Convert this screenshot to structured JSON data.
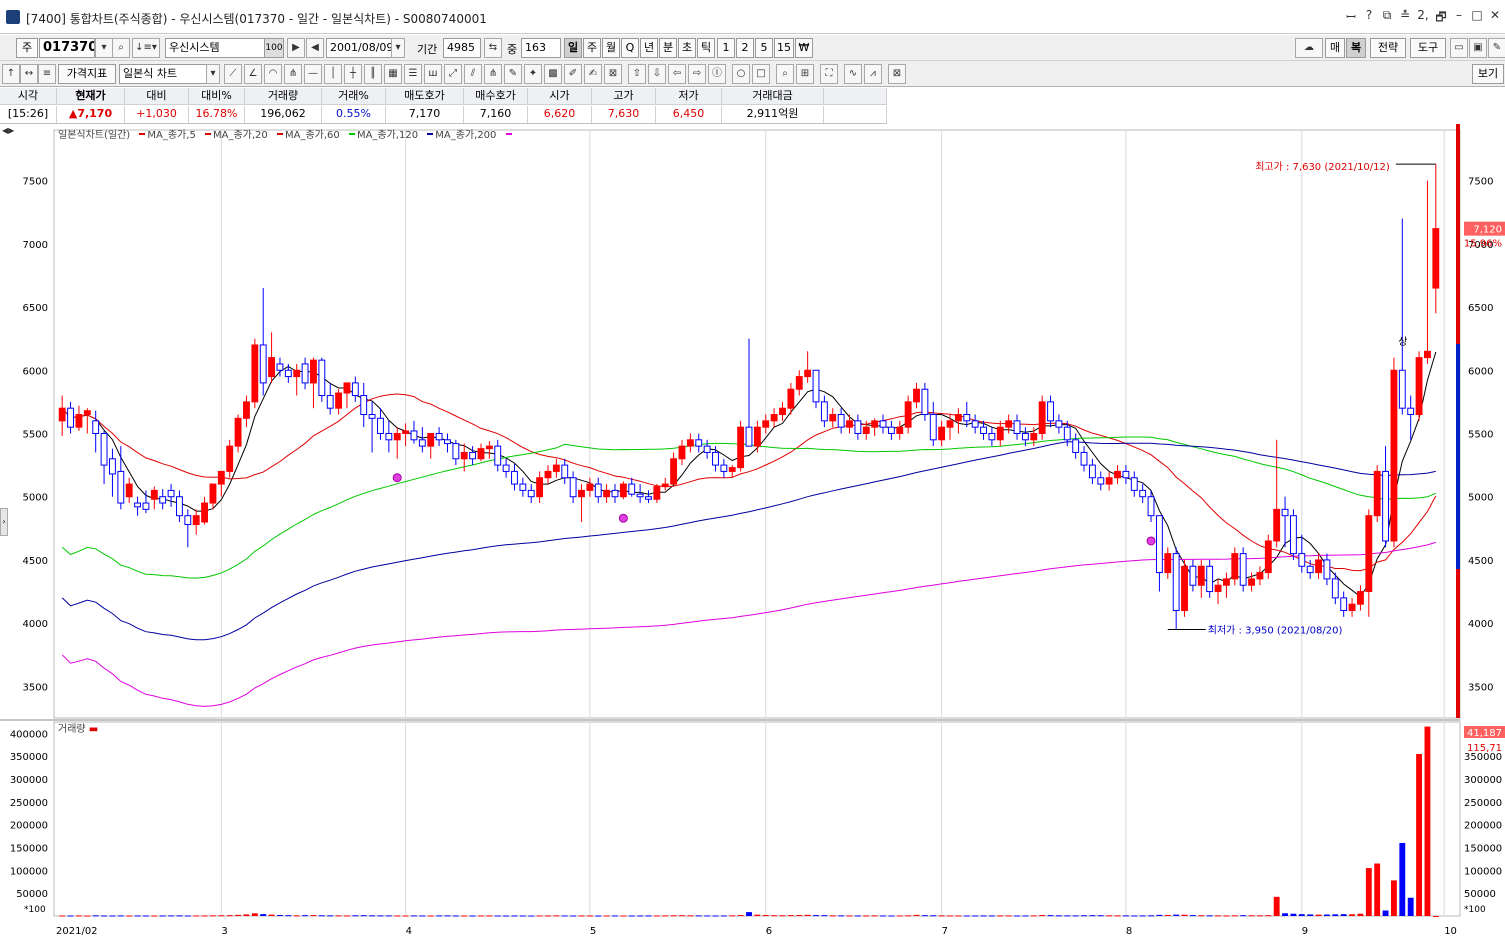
{
  "window": {
    "title": "[7400] 통합차트(주식종합) - 우신시스템(017370 - 일간 - 일본식차트) - S0080740001",
    "controls": [
      "ꟷ",
      "?",
      "⧉",
      "≛",
      "2,",
      "🗗",
      "–",
      "□",
      "✕"
    ]
  },
  "toolbar1": {
    "market": "주",
    "code": "017370",
    "name": "우신시스템",
    "name_suffix": "100",
    "date": "2001/08/09",
    "period_label": "기간",
    "period_value": "4985",
    "count_label": "중",
    "count_value": "163",
    "timeframes": [
      "일",
      "주",
      "월",
      "Q",
      "년",
      "분",
      "초",
      "틱",
      "1",
      "2",
      "5",
      "15",
      "₩"
    ],
    "right_buttons": [
      "매",
      "복",
      "전략",
      "도구"
    ]
  },
  "toolbar2": {
    "indicator_button": "가격지표",
    "chart_type": "일본식 차트",
    "view_button": "보기"
  },
  "quote": {
    "headers": [
      "시각",
      "현재가",
      "대비",
      "대비%",
      "거래량",
      "거래%",
      "매도호가",
      "매수호가",
      "시가",
      "고가",
      "저가",
      "거래대금"
    ],
    "values": [
      "[15:26]",
      "▲7,170",
      "+1,030",
      "16.78%",
      "196,062",
      "0.55%",
      "7,170",
      "7,160",
      "6,620",
      "7,630",
      "6,450",
      "2,911억원"
    ]
  },
  "chart_legend": {
    "title": "일본식차트(일간)",
    "items": [
      {
        "label": "MA_종가,5",
        "color": "#000000"
      },
      {
        "label": "MA_종가,20",
        "color": "#e00000"
      },
      {
        "label": "MA_종가,60",
        "color": "#00c800"
      },
      {
        "label": "MA_종가,120",
        "color": "#0000a0"
      },
      {
        "label": "MA_종가,200",
        "color": "#e000e0"
      }
    ]
  },
  "annotations": {
    "high": "최고가 : 7,630 (2021/10/12)",
    "low": "최저가 : 3,950 (2021/08/20)",
    "up_mark": "상",
    "current_price": "7,120",
    "current_pct": "15.96%",
    "volume_last": "41,187",
    "volume_ma": "115,71",
    "scale_tag": "*100"
  },
  "volume_legend": "거래량",
  "chart_data": [
    {
      "type": "candlestick",
      "title": "일본식차트(일간)",
      "x_labels": [
        "2021/02",
        "3",
        "4",
        "5",
        "6",
        "7",
        "8",
        "9",
        "10"
      ],
      "yticks": [
        3500,
        4000,
        4500,
        5000,
        5500,
        6000,
        6500,
        7000,
        7500
      ],
      "ylim": [
        3250,
        7900
      ],
      "candles": [
        [
          5600,
          5800,
          5480,
          5700
        ],
        [
          5700,
          5750,
          5500,
          5550
        ],
        [
          5550,
          5720,
          5520,
          5650
        ],
        [
          5650,
          5700,
          5500,
          5680
        ],
        [
          5600,
          5680,
          5350,
          5500
        ],
        [
          5500,
          5520,
          5100,
          5250
        ],
        [
          5300,
          5380,
          5000,
          5180
        ],
        [
          5200,
          5400,
          4900,
          4950
        ],
        [
          5000,
          5150,
          4950,
          5100
        ],
        [
          4950,
          5000,
          4850,
          4920
        ],
        [
          4950,
          5050,
          4870,
          4900
        ],
        [
          4980,
          5080,
          4900,
          5050
        ],
        [
          5000,
          5060,
          4900,
          4950
        ],
        [
          5050,
          5100,
          4920,
          5000
        ],
        [
          5000,
          5050,
          4800,
          4850
        ],
        [
          4850,
          4900,
          4600,
          4780
        ],
        [
          4780,
          4900,
          4700,
          4850
        ],
        [
          4800,
          5000,
          4780,
          4950
        ],
        [
          4950,
          5100,
          4900,
          5100
        ],
        [
          5100,
          5200,
          5000,
          5200
        ],
        [
          5200,
          5450,
          5150,
          5400
        ],
        [
          5400,
          5650,
          5350,
          5620
        ],
        [
          5620,
          5800,
          5550,
          5750
        ],
        [
          5750,
          6250,
          5700,
          6200
        ],
        [
          6200,
          6650,
          5800,
          5900
        ],
        [
          5950,
          6300,
          5900,
          6100
        ],
        [
          6050,
          6100,
          5950,
          6000
        ],
        [
          6000,
          6050,
          5900,
          5950
        ],
        [
          5950,
          6050,
          5800,
          6000
        ],
        [
          6050,
          6100,
          5850,
          5900
        ],
        [
          5900,
          6100,
          5700,
          6080
        ],
        [
          6080,
          6100,
          5750,
          5800
        ],
        [
          5800,
          5900,
          5650,
          5700
        ],
        [
          5700,
          5850,
          5650,
          5820
        ],
        [
          5820,
          5900,
          5700,
          5900
        ],
        [
          5900,
          5950,
          5750,
          5800
        ],
        [
          5800,
          5900,
          5550,
          5650
        ],
        [
          5650,
          5750,
          5350,
          5620
        ],
        [
          5620,
          5700,
          5450,
          5500
        ],
        [
          5500,
          5600,
          5350,
          5450
        ],
        [
          5450,
          5550,
          5300,
          5500
        ],
        [
          5500,
          5580,
          5400,
          5520
        ],
        [
          5520,
          5600,
          5420,
          5450
        ],
        [
          5450,
          5550,
          5350,
          5400
        ],
        [
          5400,
          5500,
          5300,
          5500
        ],
        [
          5500,
          5550,
          5400,
          5450
        ],
        [
          5450,
          5500,
          5350,
          5420
        ],
        [
          5420,
          5450,
          5250,
          5300
        ],
        [
          5300,
          5420,
          5200,
          5350
        ],
        [
          5350,
          5400,
          5250,
          5300
        ],
        [
          5300,
          5420,
          5280,
          5380
        ],
        [
          5380,
          5440,
          5300,
          5400
        ],
        [
          5400,
          5450,
          5200,
          5250
        ],
        [
          5250,
          5300,
          5150,
          5200
        ],
        [
          5200,
          5260,
          5050,
          5100
        ],
        [
          5100,
          5150,
          5000,
          5050
        ],
        [
          5050,
          5100,
          4950,
          5000
        ],
        [
          5000,
          5200,
          4950,
          5150
        ],
        [
          5150,
          5250,
          5100,
          5200
        ],
        [
          5200,
          5300,
          5150,
          5250
        ],
        [
          5250,
          5300,
          5100,
          5150
        ],
        [
          5150,
          5200,
          4950,
          5000
        ],
        [
          5000,
          5100,
          4800,
          5050
        ],
        [
          5050,
          5150,
          5000,
          5100
        ],
        [
          5100,
          5150,
          4950,
          5000
        ],
        [
          5000,
          5100,
          4950,
          5050
        ],
        [
          5050,
          5100,
          4950,
          5000
        ],
        [
          5000,
          5120,
          4980,
          5100
        ],
        [
          5100,
          5150,
          5000,
          5020
        ],
        [
          5020,
          5100,
          4950,
          5000
        ],
        [
          5000,
          5050,
          4950,
          4980
        ],
        [
          4980,
          5100,
          4950,
          5080
        ],
        [
          5080,
          5150,
          5050,
          5100
        ],
        [
          5100,
          5350,
          5100,
          5300
        ],
        [
          5300,
          5450,
          5250,
          5400
        ],
        [
          5400,
          5500,
          5350,
          5450
        ],
        [
          5450,
          5500,
          5350,
          5400
        ],
        [
          5400,
          5450,
          5300,
          5350
        ],
        [
          5350,
          5400,
          5200,
          5250
        ],
        [
          5250,
          5300,
          5150,
          5200
        ],
        [
          5200,
          5250,
          5150,
          5230
        ],
        [
          5230,
          5600,
          5200,
          5550
        ],
        [
          5550,
          6250,
          5450,
          5400
        ],
        [
          5400,
          5600,
          5350,
          5550
        ],
        [
          5550,
          5650,
          5500,
          5600
        ],
        [
          5600,
          5700,
          5550,
          5650
        ],
        [
          5650,
          5750,
          5600,
          5700
        ],
        [
          5700,
          5900,
          5650,
          5850
        ],
        [
          5850,
          6000,
          5800,
          5950
        ],
        [
          5950,
          6150,
          5900,
          6000
        ],
        [
          6000,
          6000,
          5700,
          5750
        ],
        [
          5750,
          5800,
          5550,
          5600
        ],
        [
          5600,
          5700,
          5550,
          5650
        ],
        [
          5650,
          5700,
          5500,
          5550
        ],
        [
          5550,
          5650,
          5500,
          5600
        ],
        [
          5600,
          5650,
          5450,
          5500
        ],
        [
          5500,
          5600,
          5450,
          5550
        ],
        [
          5550,
          5620,
          5480,
          5600
        ],
        [
          5600,
          5650,
          5500,
          5550
        ],
        [
          5550,
          5600,
          5450,
          5500
        ],
        [
          5500,
          5600,
          5450,
          5550
        ],
        [
          5550,
          5800,
          5500,
          5750
        ],
        [
          5750,
          5900,
          5700,
          5850
        ],
        [
          5850,
          5900,
          5600,
          5650
        ],
        [
          5650,
          5750,
          5400,
          5450
        ],
        [
          5450,
          5600,
          5400,
          5550
        ],
        [
          5550,
          5650,
          5450,
          5600
        ],
        [
          5600,
          5700,
          5500,
          5650
        ],
        [
          5650,
          5750,
          5550,
          5600
        ],
        [
          5600,
          5650,
          5500,
          5550
        ],
        [
          5550,
          5600,
          5450,
          5500
        ],
        [
          5500,
          5550,
          5400,
          5450
        ],
        [
          5450,
          5600,
          5400,
          5550
        ],
        [
          5550,
          5650,
          5500,
          5600
        ],
        [
          5600,
          5650,
          5450,
          5500
        ],
        [
          5500,
          5550,
          5400,
          5450
        ],
        [
          5450,
          5550,
          5400,
          5500
        ],
        [
          5500,
          5800,
          5450,
          5750
        ],
        [
          5750,
          5800,
          5550,
          5600
        ],
        [
          5600,
          5650,
          5500,
          5550
        ],
        [
          5550,
          5600,
          5400,
          5450
        ],
        [
          5450,
          5500,
          5300,
          5350
        ],
        [
          5350,
          5400,
          5200,
          5250
        ],
        [
          5250,
          5300,
          5100,
          5150
        ],
        [
          5150,
          5200,
          5050,
          5100
        ],
        [
          5100,
          5200,
          5050,
          5150
        ],
        [
          5150,
          5250,
          5100,
          5200
        ],
        [
          5200,
          5250,
          5100,
          5150
        ],
        [
          5150,
          5200,
          5000,
          5050
        ],
        [
          5050,
          5100,
          4950,
          5000
        ],
        [
          5000,
          5050,
          4800,
          4850
        ],
        [
          4850,
          4850,
          4250,
          4400
        ],
        [
          4400,
          4600,
          4350,
          4550
        ],
        [
          4550,
          4600,
          3950,
          4100
        ],
        [
          4100,
          4500,
          4050,
          4450
        ],
        [
          4450,
          4500,
          4250,
          4300
        ],
        [
          4300,
          4500,
          4200,
          4450
        ],
        [
          4450,
          4500,
          4200,
          4250
        ],
        [
          4250,
          4350,
          4150,
          4300
        ],
        [
          4300,
          4400,
          4200,
          4350
        ],
        [
          4350,
          4600,
          4300,
          4550
        ],
        [
          4550,
          4600,
          4250,
          4300
        ],
        [
          4300,
          4400,
          4250,
          4350
        ],
        [
          4350,
          4450,
          4300,
          4400
        ],
        [
          4400,
          4700,
          4350,
          4650
        ],
        [
          4650,
          5450,
          4600,
          4900
        ],
        [
          4900,
          5000,
          4600,
          4850
        ],
        [
          4850,
          4900,
          4500,
          4550
        ],
        [
          4550,
          4700,
          4400,
          4450
        ],
        [
          4450,
          4500,
          4350,
          4400
        ],
        [
          4400,
          4550,
          4350,
          4500
        ],
        [
          4500,
          4550,
          4300,
          4350
        ],
        [
          4350,
          4400,
          4150,
          4200
        ],
        [
          4200,
          4250,
          4050,
          4100
        ],
        [
          4100,
          4200,
          4050,
          4150
        ],
        [
          4150,
          4300,
          4100,
          4250
        ],
        [
          4250,
          4900,
          4050,
          4850
        ],
        [
          4850,
          5250,
          4800,
          5200
        ],
        [
          5200,
          5400,
          4600,
          4650
        ],
        [
          4650,
          6100,
          4600,
          6000
        ],
        [
          6000,
          7200,
          5650,
          5700
        ],
        [
          5700,
          5800,
          5450,
          5650
        ],
        [
          5650,
          6150,
          5600,
          6100
        ],
        [
          6100,
          7500,
          6050,
          6150
        ],
        [
          6650,
          7630,
          6450,
          7120
        ]
      ]
    },
    {
      "type": "bar",
      "title": "거래량",
      "yticks": [
        50000,
        100000,
        150000,
        200000,
        250000,
        300000,
        350000,
        400000
      ],
      "ylim": [
        0,
        425000
      ],
      "values_note": "last candles volume",
      "values": [
        1200,
        1100,
        1300,
        1000,
        1500,
        1200,
        1100,
        1300,
        1000,
        1200,
        1100,
        1000,
        1200,
        1300,
        1400,
        1100,
        1200,
        1300,
        1500,
        1600,
        1800,
        2500,
        3500,
        6000,
        4200,
        3000,
        2200,
        1800,
        1500,
        1800,
        2000,
        1600,
        1500,
        1400,
        1300,
        1600,
        1800,
        1500,
        1400,
        1300,
        1200,
        1100,
        1300,
        1200,
        1100,
        1300,
        1400,
        1200,
        1100,
        1000,
        1200,
        1300,
        1100,
        1000,
        1200,
        1100,
        1000,
        1200,
        1300,
        1400,
        1200,
        1100,
        1300,
        1200,
        1000,
        1100,
        1200,
        1000,
        1100,
        1200,
        1300,
        1200,
        1400,
        1600,
        1800,
        1500,
        1300,
        1200,
        1100,
        1200,
        1500,
        2200,
        8500,
        3000,
        2200,
        1800,
        1600,
        1900,
        2200,
        2500,
        2000,
        1800,
        1500,
        1400,
        1300,
        1200,
        1300,
        1400,
        1200,
        1100,
        1200,
        1500,
        2500,
        1800,
        1600,
        1400,
        1300,
        1200,
        1100,
        1200,
        1300,
        1200,
        1400,
        1300,
        1100,
        1200,
        1300,
        2200,
        1800,
        1500,
        1400,
        1300,
        1600,
        1800,
        1700,
        1500,
        1400,
        1300,
        1200,
        1300,
        1500,
        2500,
        2200,
        3000,
        2800,
        2000,
        1700,
        1500,
        1400,
        1300,
        1500,
        1800,
        1600,
        1500,
        1800,
        42000,
        6000,
        5000,
        4000,
        3500,
        3000,
        3200,
        3600,
        4000,
        3800,
        5000,
        105000,
        115000,
        12000,
        78000,
        160000,
        40000,
        355000,
        415000,
        0
      ]
    }
  ]
}
